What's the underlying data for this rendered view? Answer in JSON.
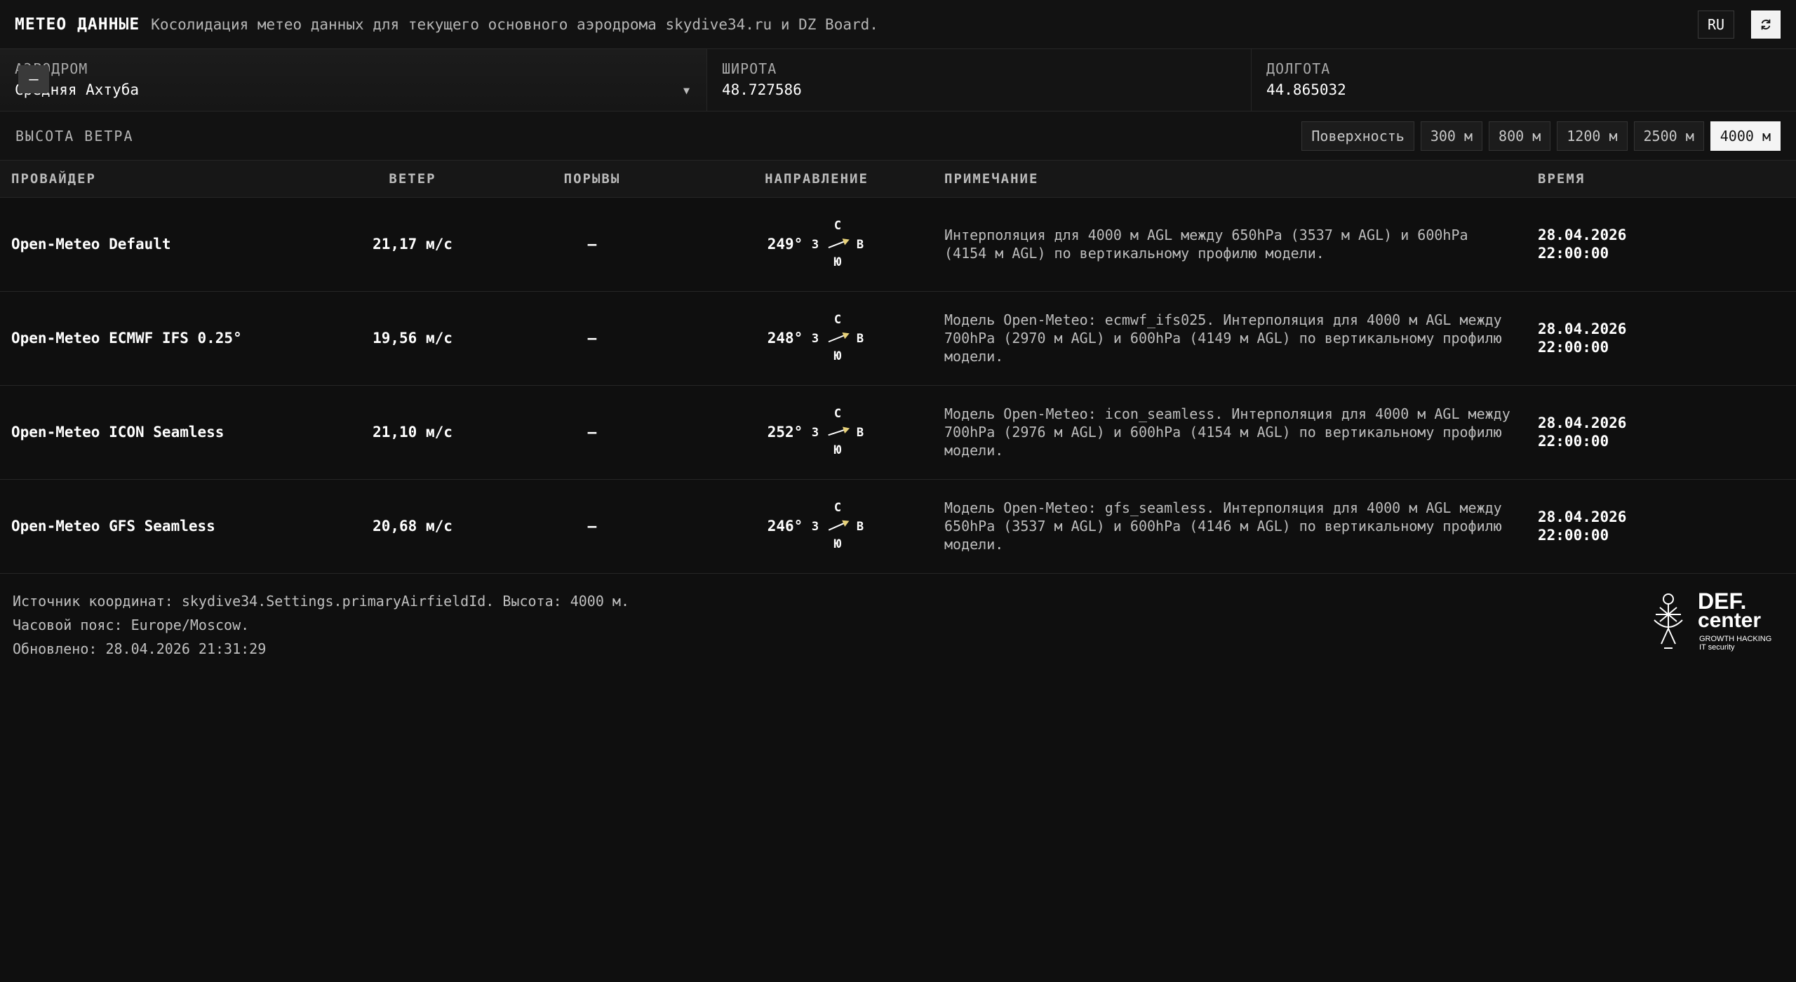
{
  "header": {
    "brand": "МЕТЕО ДАННЫЕ",
    "subtitle": "Косолидация метео данных для текущего основного аэродрома skydive34.ru и DZ Board.",
    "lang": "RU"
  },
  "fields": {
    "airfield": {
      "label": "АЭРОДРОМ",
      "value": "Средняя Ахтуба"
    },
    "latitude": {
      "label": "ШИРОТА",
      "value": "48.727586"
    },
    "longitude": {
      "label": "ДОЛГОТА",
      "value": "44.865032"
    },
    "overlay_badge": "—"
  },
  "altitude": {
    "label": "ВЫСОТА ВЕТРА",
    "options": [
      "Поверхность",
      "300 м",
      "800 м",
      "1200 м",
      "2500 м",
      "4000 м"
    ],
    "selected": "4000 м"
  },
  "table": {
    "columns": [
      "ПРОВАЙДЕР",
      "ВЕТЕР",
      "ПОРЫВЫ",
      "НАПРАВЛЕНИЕ",
      "ПРИМЕЧАНИЕ",
      "ВРЕМЯ"
    ],
    "compass": {
      "n": "С",
      "s": "Ю",
      "w": "З",
      "e": "В"
    },
    "rows": [
      {
        "provider": "Open-Meteo Default",
        "wind": "21,17 м/с",
        "gusts": "—",
        "direction": "249°",
        "note": "Интерполяция для 4000 м AGL между 650hPa (3537 м AGL) и 600hPa (4154 м AGL) по вертикальному профилю модели.",
        "date": "28.04.2026",
        "time": "22:00:00"
      },
      {
        "provider": "Open-Meteo ECMWF IFS 0.25°",
        "wind": "19,56 м/с",
        "gusts": "—",
        "direction": "248°",
        "note": "Модель Open-Meteo: ecmwf_ifs025. Интерполяция для 4000 м AGL между 700hPa (2970 м AGL) и 600hPa (4149 м AGL) по вертикальному профилю модели.",
        "date": "28.04.2026",
        "time": "22:00:00"
      },
      {
        "provider": "Open-Meteo ICON Seamless",
        "wind": "21,10 м/с",
        "gusts": "—",
        "direction": "252°",
        "note": "Модель Open-Meteo: icon_seamless. Интерполяция для 4000 м AGL между 700hPa (2976 м AGL) и 600hPa (4154 м AGL) по вертикальному профилю модели.",
        "date": "28.04.2026",
        "time": "22:00:00"
      },
      {
        "provider": "Open-Meteo GFS Seamless",
        "wind": "20,68 м/с",
        "gusts": "—",
        "direction": "246°",
        "note": "Модель Open-Meteo: gfs_seamless. Интерполяция для 4000 м AGL между 650hPa (3537 м AGL) и 600hPa (4146 м AGL) по вертикальному профилю модели.",
        "date": "28.04.2026",
        "time": "22:00:00"
      }
    ]
  },
  "footer": {
    "source": "Источник координат: skydive34.Settings.primaryAirfieldId. Высота: 4000 м.",
    "timezone": "Часовой пояс: Europe/Moscow.",
    "updated": "Обновлено: 28.04.2026 21:31:29"
  },
  "logo": {
    "line1": "DEF.",
    "line2": "center",
    "tag1": "GROWTH HACKING",
    "tag2": "IT security"
  }
}
